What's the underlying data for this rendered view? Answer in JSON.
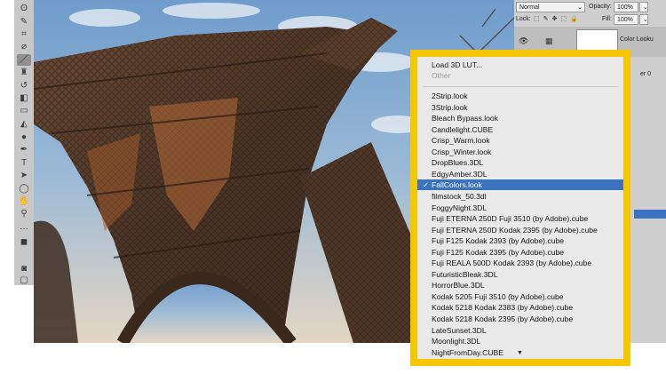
{
  "toolbar": {
    "tools": [
      {
        "name": "lasso-tool-icon",
        "glyph": "ʘ"
      },
      {
        "name": "quick-select-tool-icon",
        "glyph": "✎"
      },
      {
        "name": "crop-tool-icon",
        "glyph": "⌗"
      },
      {
        "name": "eyedropper-tool-icon",
        "glyph": "⌀"
      },
      {
        "name": "brush-tool-icon",
        "glyph": "／"
      },
      {
        "name": "stamp-tool-icon",
        "glyph": "♜"
      },
      {
        "name": "history-brush-icon",
        "glyph": "↺"
      },
      {
        "name": "eraser-tool-icon",
        "glyph": "◧"
      },
      {
        "name": "gradient-tool-icon",
        "glyph": "▭"
      },
      {
        "name": "blur-tool-icon",
        "glyph": "◭"
      },
      {
        "name": "dodge-tool-icon",
        "glyph": "●"
      },
      {
        "name": "pen-tool-icon",
        "glyph": "✒"
      },
      {
        "name": "type-tool-icon",
        "glyph": "T"
      },
      {
        "name": "path-select-tool-icon",
        "glyph": "➤"
      },
      {
        "name": "shape-tool-icon",
        "glyph": "◯"
      },
      {
        "name": "hand-tool-icon",
        "glyph": "✋"
      },
      {
        "name": "zoom-tool-icon",
        "glyph": "⚲"
      },
      {
        "name": "more-tools-icon",
        "glyph": "…"
      },
      {
        "name": "color-swatches-icon",
        "glyph": "◼"
      },
      {
        "name": "quick-mask-icon",
        "glyph": "◙"
      },
      {
        "name": "screen-mode-icon",
        "glyph": "▢"
      }
    ]
  },
  "panel": {
    "blend_mode": "Normal",
    "opacity_label": "Opacity:",
    "opacity_value": "100%",
    "lock_label": "Lock:",
    "fill_label": "Fill:",
    "fill_value": "100%",
    "layer_name": "Color Looku",
    "partial_text": "er 0"
  },
  "menu": {
    "load_item": "Load 3D LUT...",
    "other_item": "Other",
    "selected_index": 8,
    "items": [
      "2Strip.look",
      "3Strip.look",
      "Bleach Bypass.look",
      "Candlelight.CUBE",
      "Crisp_Warm.look",
      "Crisp_Winter.look",
      "DropBlues.3DL",
      "EdgyAmber.3DL",
      "FallColors.look",
      "filmstock_50.3dl",
      "FoggyNight.3DL",
      "Fuji ETERNA 250D Fuji 3510 (by Adobe).cube",
      "Fuji ETERNA 250D Kodak 2395 (by Adobe).cube",
      "Fuji F125 Kodak 2393 (by Adobe).cube",
      "Fuji F125 Kodak 2395 (by Adobe).cube",
      "Fuji REALA 500D Kodak 2393 (by Adobe).cube",
      "FuturisticBleak.3DL",
      "HorrorBlue.3DL",
      "Kodak 5205 Fuji 3510 (by Adobe).cube",
      "Kodak 5218 Kodak 2383 (by Adobe).cube",
      "Kodak 5218 Kodak 2395 (by Adobe).cube",
      "LateSunset.3DL",
      "Moonlight.3DL",
      "NightFromDay.CUBE"
    ],
    "checkmark": "✓",
    "scroll_down_glyph": "▼"
  },
  "colors": {
    "highlight": "#f6c700",
    "selection": "#3b73c0"
  }
}
